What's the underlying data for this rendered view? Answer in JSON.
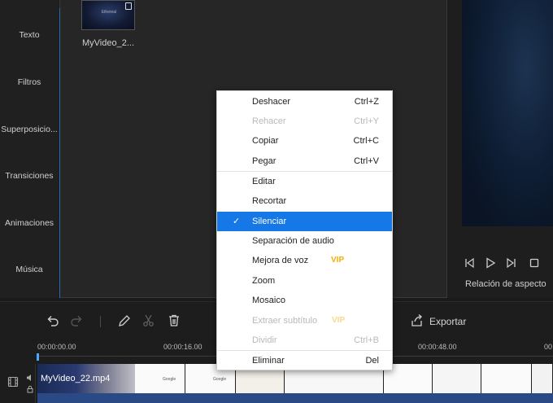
{
  "sidebar": {
    "items": [
      {
        "label": "Texto"
      },
      {
        "label": "Filtros"
      },
      {
        "label": "Superposicio..."
      },
      {
        "label": "Transiciones"
      },
      {
        "label": "Animaciones"
      },
      {
        "label": "Música"
      }
    ]
  },
  "library": {
    "media": [
      {
        "name": "MyVideo_2...",
        "thumb_caption": "Ethereal"
      }
    ]
  },
  "preview": {
    "aspect_label": "Relación de aspecto"
  },
  "toolbar": {
    "export_label": "Exportar"
  },
  "timeline": {
    "ticks": [
      "00:00:00.00",
      "00:00:16.00",
      "00:00:48.00",
      "00"
    ],
    "clip_name": "MyVideo_22.mp4",
    "thumb_brand": "Google"
  },
  "context_menu": {
    "items": [
      {
        "label": "Deshacer",
        "shortcut": "Ctrl+Z",
        "enabled": true
      },
      {
        "label": "Rehacer",
        "shortcut": "Ctrl+Y",
        "enabled": false
      },
      {
        "label": "Copiar",
        "shortcut": "Ctrl+C",
        "enabled": true
      },
      {
        "label": "Pegar",
        "shortcut": "Ctrl+V",
        "enabled": true
      },
      {
        "label": "Editar",
        "enabled": true
      },
      {
        "label": "Recortar",
        "enabled": true
      },
      {
        "label": "Silenciar",
        "enabled": true,
        "checked": true,
        "selected": true
      },
      {
        "label": "Separación de audio",
        "enabled": true
      },
      {
        "label": "Mejora de voz",
        "badge": "VIP",
        "enabled": true
      },
      {
        "label": "Zoom",
        "enabled": true
      },
      {
        "label": "Mosaico",
        "enabled": true
      },
      {
        "label": "Extraer subtítulo",
        "badge": "VIP",
        "enabled": false
      },
      {
        "label": "Dividir",
        "shortcut": "Ctrl+B",
        "enabled": false
      },
      {
        "label": "Eliminar",
        "shortcut": "Del",
        "enabled": true
      }
    ]
  },
  "colors": {
    "accent": "#1677e6",
    "vip": "#f2b000",
    "playhead": "#4aa8ff"
  }
}
